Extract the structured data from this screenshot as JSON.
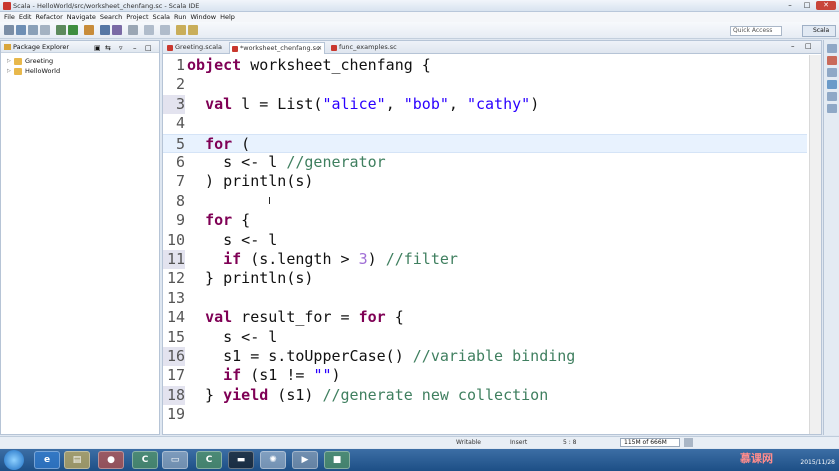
{
  "window": {
    "title": "Scala - HelloWorld/src/worksheet_chenfang.sc - Scala IDE",
    "minimize": "–",
    "maximize": "□",
    "close": "✕"
  },
  "menu": [
    "File",
    "Edit",
    "Refactor",
    "Navigate",
    "Search",
    "Project",
    "Scala",
    "Run",
    "Window",
    "Help"
  ],
  "toolbar": {
    "quick_access": "Quick Access",
    "perspective": "Scala"
  },
  "explorer": {
    "title": "Package Explorer",
    "items": [
      "Greeting",
      "HelloWorld"
    ]
  },
  "editor": {
    "tabs": [
      "Greeting.scala",
      "*worksheet_chenfang.sc",
      "func_examples.sc"
    ],
    "lines": [
      {
        "n": "1",
        "parts": [
          [
            "kw",
            "object"
          ],
          [
            "",
            " worksheet_chenfang {"
          ]
        ]
      },
      {
        "n": "2",
        "parts": []
      },
      {
        "n": "3",
        "parts": [
          [
            "",
            "  "
          ],
          [
            "kw",
            "val"
          ],
          [
            "",
            " l = List("
          ],
          [
            "str",
            "\"alice\""
          ],
          [
            "",
            ", "
          ],
          [
            "str",
            "\"bob\""
          ],
          [
            "",
            ", "
          ],
          [
            "str",
            "\"cathy\""
          ],
          [
            "",
            ")"
          ]
        ]
      },
      {
        "n": "4",
        "parts": []
      },
      {
        "n": "5",
        "parts": [
          [
            "",
            "  "
          ],
          [
            "kw",
            "for"
          ],
          [
            "",
            " ("
          ]
        ]
      },
      {
        "n": "6",
        "parts": [
          [
            "",
            "    s <- l "
          ],
          [
            "cm",
            "//generator"
          ]
        ]
      },
      {
        "n": "7",
        "parts": [
          [
            "",
            "  ) println(s)"
          ]
        ]
      },
      {
        "n": "8",
        "parts": []
      },
      {
        "n": "9",
        "parts": [
          [
            "",
            "  "
          ],
          [
            "kw",
            "for"
          ],
          [
            "",
            " {"
          ]
        ]
      },
      {
        "n": "10",
        "parts": [
          [
            "",
            "    s <- l"
          ]
        ]
      },
      {
        "n": "11",
        "parts": [
          [
            "",
            "    "
          ],
          [
            "kw",
            "if"
          ],
          [
            "",
            " (s.length > "
          ],
          [
            "num",
            "3"
          ],
          [
            "",
            ") "
          ],
          [
            "cm",
            "//filter"
          ]
        ]
      },
      {
        "n": "12",
        "parts": [
          [
            "",
            "  } println(s)"
          ]
        ]
      },
      {
        "n": "13",
        "parts": []
      },
      {
        "n": "14",
        "parts": [
          [
            "",
            "  "
          ],
          [
            "kw",
            "val"
          ],
          [
            "",
            " result_for = "
          ],
          [
            "kw",
            "for"
          ],
          [
            "",
            " {"
          ]
        ]
      },
      {
        "n": "15",
        "parts": [
          [
            "",
            "    s <- l"
          ]
        ]
      },
      {
        "n": "16",
        "parts": [
          [
            "",
            "    s1 = s.toUpperCase() "
          ],
          [
            "cm",
            "//variable binding"
          ]
        ]
      },
      {
        "n": "17",
        "parts": [
          [
            "",
            "    "
          ],
          [
            "kw",
            "if"
          ],
          [
            "",
            " (s1 != "
          ],
          [
            "str",
            "\"\""
          ],
          [
            "",
            ")"
          ]
        ]
      },
      {
        "n": "18",
        "parts": [
          [
            "",
            "  } "
          ],
          [
            "kw",
            "yield"
          ],
          [
            "",
            " (s1) "
          ],
          [
            "cm",
            "//generate new collection"
          ]
        ]
      },
      {
        "n": "19",
        "parts": []
      }
    ],
    "marked_lines": [
      "3",
      "11",
      "16",
      "18"
    ],
    "current_line": "5"
  },
  "status": {
    "writable": "Writable",
    "insert": "Insert",
    "position": "5 : 8",
    "memory": "115M of 666M"
  },
  "taskbar": {
    "apps": [
      "ie-icon",
      "folder-icon",
      "chrome-icon",
      "scala-ide-icon",
      "scala-ide-2-icon",
      "terminal-icon",
      "settings-icon",
      "media-icon",
      "app-icon"
    ],
    "date": "2015/11/28"
  },
  "watermark": "慕课网",
  "colors": {
    "keyword": "#7f0055",
    "string": "#2a00ff",
    "comment": "#3f7f5f",
    "number": "#a06fd6"
  }
}
